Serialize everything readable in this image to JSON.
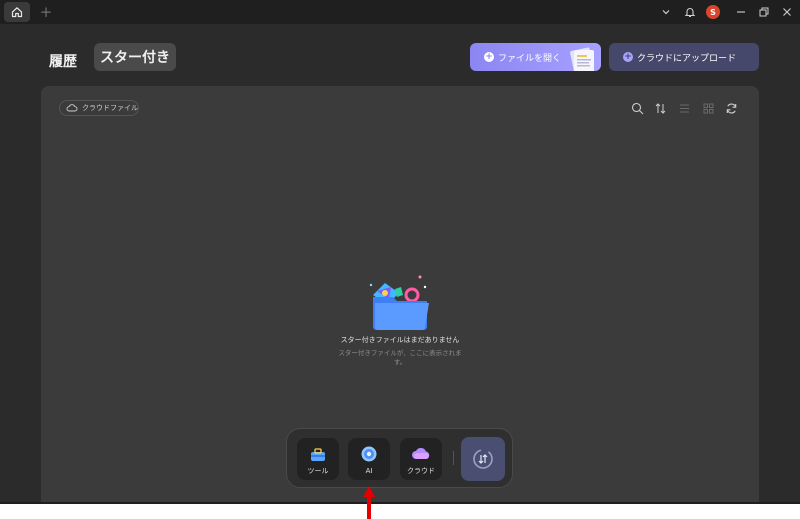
{
  "titlebar": {
    "home_icon": "home-icon",
    "new_tab_glyph": "+",
    "avatar_letter": "S",
    "avatar_color": "#d9452c"
  },
  "nav": {
    "history_label": "履歴",
    "starred_label": "スター付き"
  },
  "actions": {
    "open_file_label": "ファイルを開く",
    "upload_cloud_label": "クラウドにアップロード",
    "accent_color": "#9b96f8"
  },
  "panel": {
    "cloud_files_label": "クラウドファイル",
    "empty_title": "スター付きファイルはまだありません",
    "empty_subtitle": "スター付きファイルが、ここに表示されます。"
  },
  "dock": {
    "tools_label": "ツール",
    "ai_label": "AI",
    "cloud_label": "クラウド"
  }
}
